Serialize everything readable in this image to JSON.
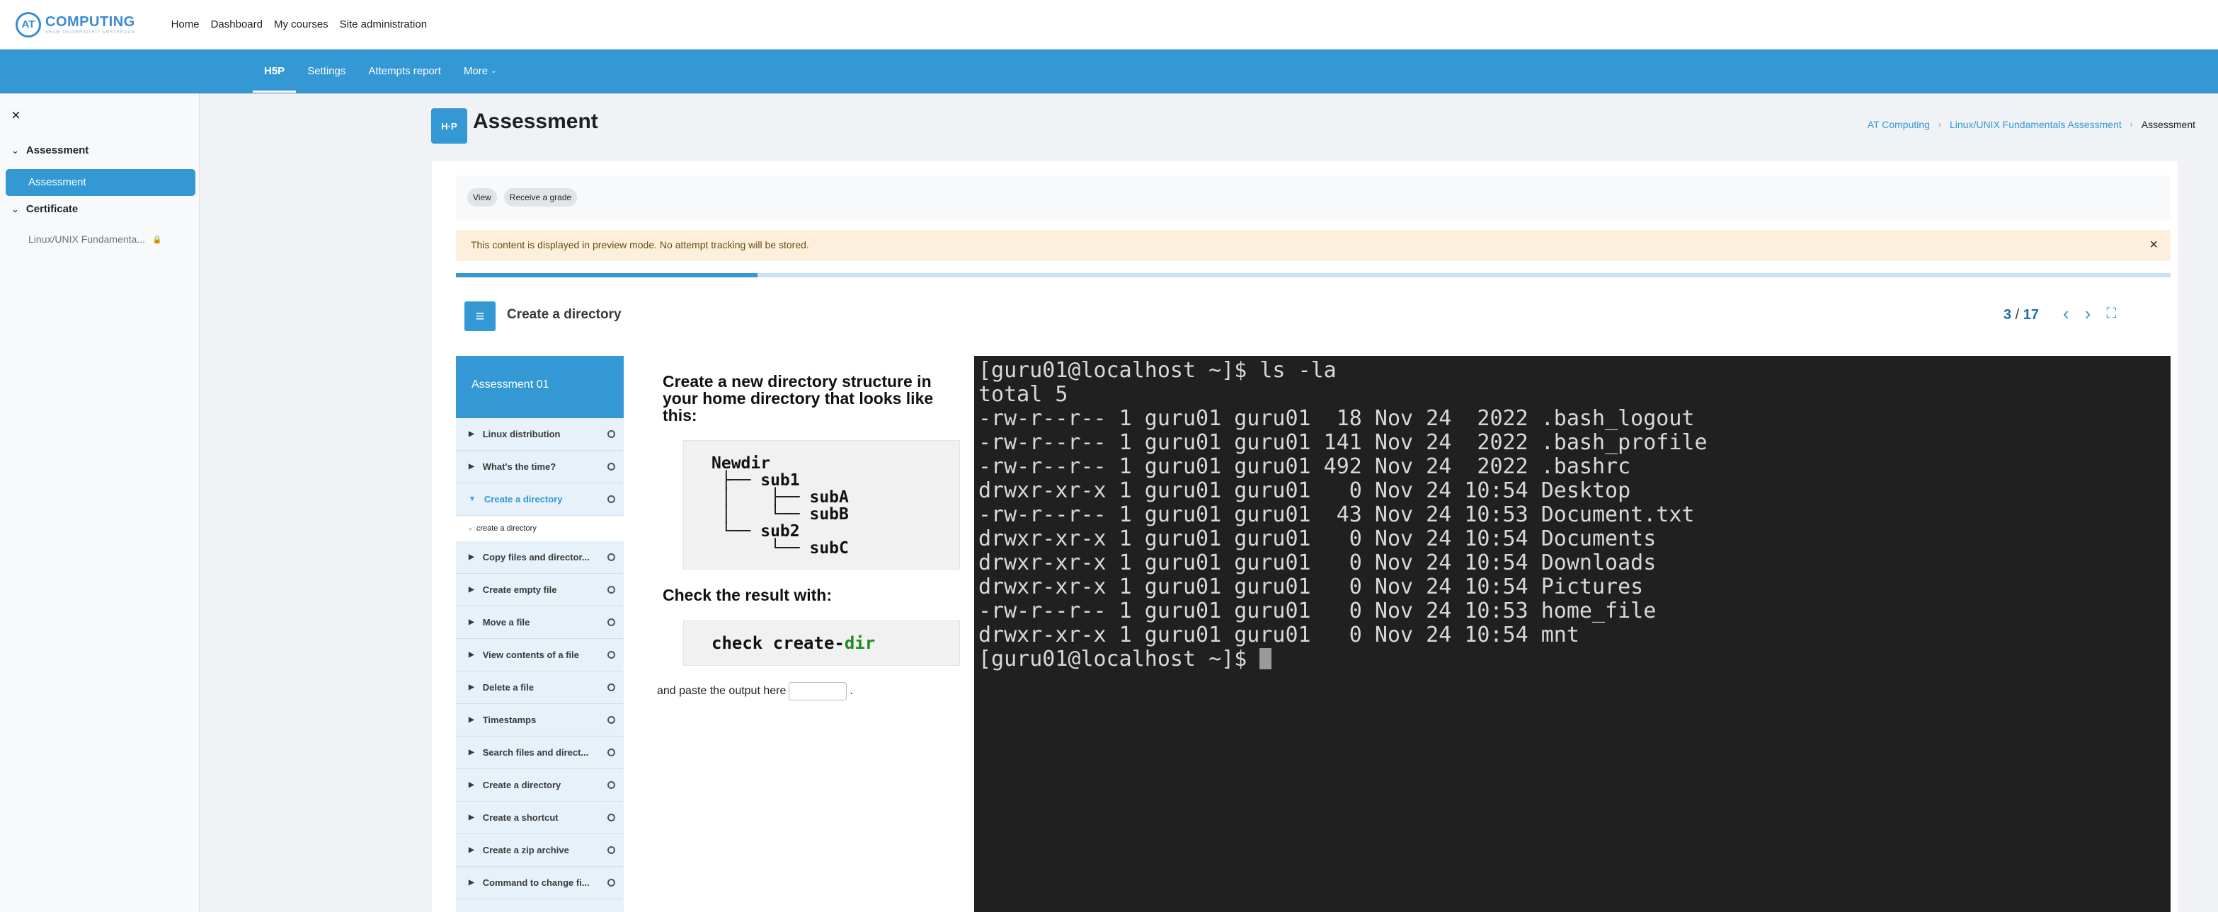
{
  "topbar": {
    "logo_mark": "AT",
    "logo_name": "COMPUTING",
    "logo_tagline": "VRIJE UNIVERSITEIT AMSTERDAM",
    "nav": [
      "Home",
      "Dashboard",
      "My courses",
      "Site administration"
    ]
  },
  "secondary_nav": {
    "tabs": [
      "H5P",
      "Settings",
      "Attempts report",
      "More"
    ],
    "active": "H5P"
  },
  "drawer": {
    "close_icon": "×",
    "sections": [
      {
        "title": "Assessment",
        "items": [
          "Assessment"
        ]
      },
      {
        "title": "Certificate",
        "items": [
          "Linux/UNIX Fundamenta..."
        ]
      }
    ]
  },
  "page": {
    "icon_text": "H·P",
    "title": "Assessment",
    "breadcrumbs": [
      "AT Computing",
      "Linux/UNIX Fundamentals Assessment",
      "Assessment"
    ]
  },
  "activity_nav": {
    "view": "View",
    "receive_grade": "Receive a grade"
  },
  "alert": {
    "text": "This content is displayed in preview mode. No attempt tracking will be stored."
  },
  "progress": {
    "value": 0.176
  },
  "h5p": {
    "slide_title": "Create a directory",
    "current_page": "3",
    "total_pages": "17",
    "toc_title": "Assessment 01",
    "toc": [
      {
        "label": "Linux distribution"
      },
      {
        "label": "What's the time?"
      },
      {
        "label": "Create a directory",
        "current": true,
        "sub": "create a directory"
      },
      {
        "label": "Copy files and director..."
      },
      {
        "label": "Create empty file"
      },
      {
        "label": "Move a file"
      },
      {
        "label": "View contents of a file"
      },
      {
        "label": "Delete a file"
      },
      {
        "label": "Timestamps"
      },
      {
        "label": "Search files and direct..."
      },
      {
        "label": "Create a directory"
      },
      {
        "label": "Create a shortcut"
      },
      {
        "label": "Create a zip archive"
      },
      {
        "label": "Command to change fi..."
      }
    ]
  },
  "task": {
    "instruction": "Create a new directory structure in your home directory that looks like this:",
    "tree": "Newdir\n ├── sub1\n │    ├── subA\n │    └── subB\n └── sub2\n      └── subC",
    "check_heading": "Check the result with:",
    "command_prefix": "check create-",
    "command_suffix": "dir",
    "paste_label": "and paste the output here",
    "paste_end": "."
  },
  "terminal": {
    "lines": [
      "[guru01@localhost ~]$ ls -la",
      "total 5",
      "-rw-r--r-- 1 guru01 guru01  18 Nov 24  2022 .bash_logout",
      "-rw-r--r-- 1 guru01 guru01 141 Nov 24  2022 .bash_profile",
      "-rw-r--r-- 1 guru01 guru01 492 Nov 24  2022 .bashrc",
      "drwxr-xr-x 1 guru01 guru01   0 Nov 24 10:54 Desktop",
      "-rw-r--r-- 1 guru01 guru01  43 Nov 24 10:53 Document.txt",
      "drwxr-xr-x 1 guru01 guru01   0 Nov 24 10:54 Documents",
      "drwxr-xr-x 1 guru01 guru01   0 Nov 24 10:54 Downloads",
      "drwxr-xr-x 1 guru01 guru01   0 Nov 24 10:54 Pictures",
      "-rw-r--r-- 1 guru01 guru01   0 Nov 24 10:53 home_file",
      "drwxr-xr-x 1 guru01 guru01   0 Nov 24 10:54 mnt"
    ],
    "prompt": "[guru01@localhost ~]$ "
  },
  "colors": {
    "accent": "#3398d4",
    "terminal_bg": "#202020",
    "alert_bg": "#fcefdc"
  }
}
